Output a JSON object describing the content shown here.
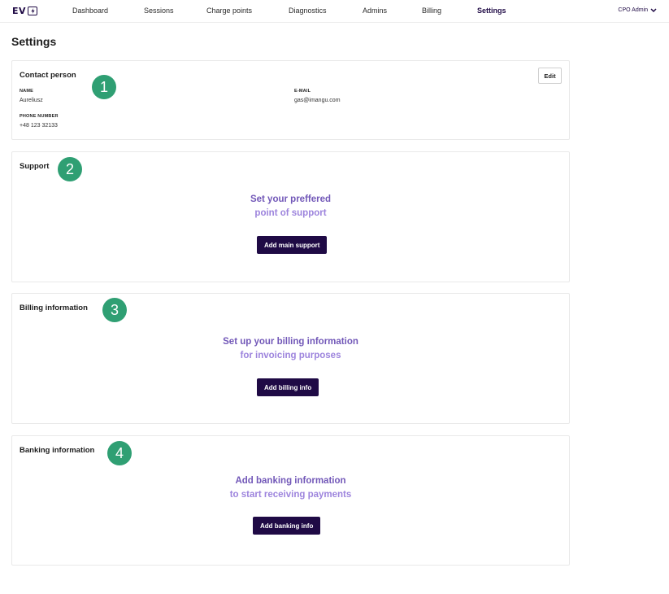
{
  "brand": {
    "logo_text": "EV"
  },
  "nav": {
    "items": [
      {
        "label": "Dashboard"
      },
      {
        "label": "Sessions"
      },
      {
        "label": "Charge points"
      },
      {
        "label": "Diagnostics"
      },
      {
        "label": "Admins"
      },
      {
        "label": "Billing"
      },
      {
        "label": "Settings",
        "active": true
      }
    ],
    "user": "CPO Admin"
  },
  "page": {
    "title": "Settings"
  },
  "contact": {
    "title": "Contact person",
    "edit_label": "Edit",
    "name_label": "NAME",
    "name": "Aureliusz",
    "email_label": "E-MAIL",
    "email": "gas@imangu.com",
    "phone_label": "PHONE NUMBER",
    "phone": "+48 123 32133"
  },
  "support": {
    "title": "Support",
    "line1": "Set your preffered",
    "line2": "point of support",
    "button": "Add main support"
  },
  "billing": {
    "title": "Billing information",
    "line1": "Set up your billing information",
    "line2": "for invoicing purposes",
    "button": "Add billing info"
  },
  "banking": {
    "title": "Banking information",
    "line1": "Add banking information",
    "line2": "to start receiving payments",
    "button": "Add banking info"
  },
  "badges": [
    "1",
    "2",
    "3",
    "4"
  ],
  "colors": {
    "primary": "#1f0a45",
    "accent_purple": "#7258b8",
    "accent_purple_light": "#9d84dd",
    "badge_green": "#2f9f73"
  }
}
